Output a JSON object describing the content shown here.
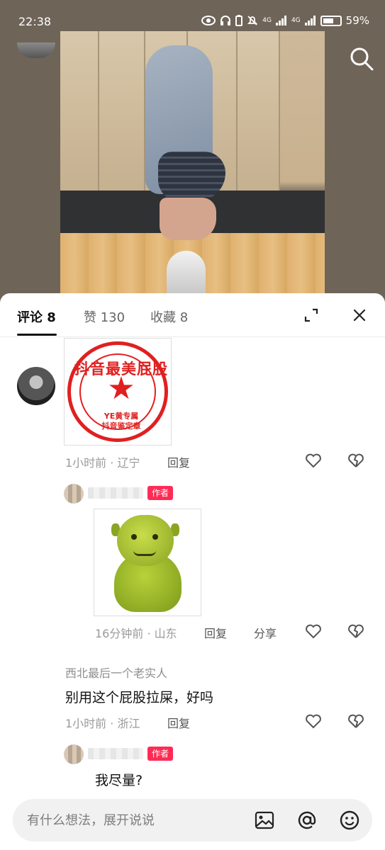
{
  "status_bar": {
    "time": "22:38",
    "network_1": "4G",
    "network_2": "4G",
    "battery_percent": "59%"
  },
  "tabs": [
    {
      "label": "评论 8"
    },
    {
      "label": "赞 130"
    },
    {
      "label": "收藏 8"
    }
  ],
  "comments": [
    {
      "sticker": {
        "arc_text": "抖音最美屁股",
        "line1": "YE黄专属",
        "line2": "抖音鉴定章"
      },
      "time_location": "1小时前 · 辽宁",
      "reply_label": "回复"
    },
    {
      "author_badge": "作者",
      "time_location": "16分钟前 · 山东",
      "reply_label": "回复",
      "share_label": "分享"
    },
    {
      "username": "西北最后一个老实人",
      "text": "别用这个屁股拉屎，好吗",
      "time_location": "1小时前 · 浙江",
      "reply_label": "回复"
    },
    {
      "author_badge": "作者",
      "text": "我尽量?"
    }
  ],
  "input": {
    "placeholder": "有什么想法，展开说说"
  },
  "colors": {
    "accent_badge": "#fe2c55",
    "seal_red": "#e02020"
  },
  "icons": [
    "search-icon",
    "expand-icon",
    "close-icon",
    "heart-icon",
    "broken-heart-icon",
    "image-icon",
    "at-icon",
    "emoji-icon"
  ]
}
